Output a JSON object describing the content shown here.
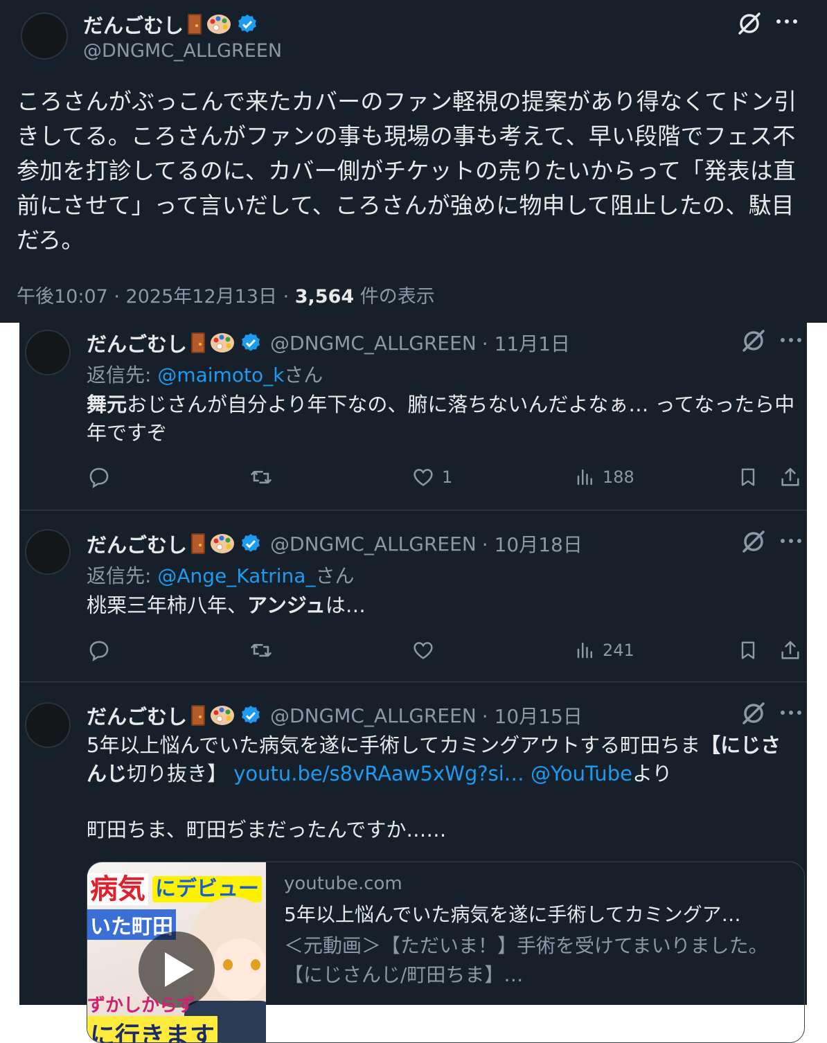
{
  "top_tweet": {
    "name": "だんごむし",
    "handle": "@DNGMC_ALLGREEN",
    "body": "ころさんがぶっこんで来たカバーのファン軽視の提案があり得なくてドン引きしてる。ころさんがファンの事も現場の事も考えて、早い段階でフェス不参加を打診してるのに、カバー側がチケットの売りたいからって「発表は直前にさせて」って言いだして、ころさんが強めに物申して阻止したの、駄目だろ。",
    "time": "午後10:07 · 2025年12月13日 · ",
    "views": "3,564",
    "views_label": " 件の表示"
  },
  "timeline": [
    {
      "name": "だんごむし",
      "handle": "@DNGMC_ALLGREEN",
      "date": "· 11月1日",
      "reply_label": "返信先: ",
      "reply_to": "@maimoto_k",
      "reply_suffix": "さん",
      "text_bold": "舞元",
      "text": "おじさんが自分より年下なの、腑に落ちないんだよなぁ… ってなったら中年ですぞ",
      "likes": "1",
      "views": "188"
    },
    {
      "name": "だんごむし",
      "handle": "@DNGMC_ALLGREEN",
      "date": "· 10月18日",
      "reply_label": "返信先: ",
      "reply_to": "@Ange_Katrina_",
      "reply_suffix": "さん",
      "text_pre": "桃栗三年柿八年、",
      "text_bold": "アンジュ",
      "text_post": "は…",
      "likes": "",
      "views": "241"
    },
    {
      "name": "だんごむし",
      "handle": "@DNGMC_ALLGREEN",
      "date": "· 10月15日",
      "text_pre": "5年以上悩んでいた病気を遂に手術してカミングアウトする町田ちま",
      "text_bold": "【にじさんじ",
      "text_mid": "切り抜き】 ",
      "link1": "youtu.be/s8vRAaw5xWg?si…",
      "link2": "@YouTube",
      "text_post": "より",
      "text2": "町田ちま、町田ぢまだったんですか……",
      "card": {
        "domain": "youtube.com",
        "title": "5年以上悩んでいた病気を遂に手術してカミングア…",
        "description": "＜元動画＞【ただいま！】手術を受けてまいりました。【にじさんじ/町田ちま】…",
        "thumb_line1": "病気",
        "thumb_line2": "にデビュー",
        "thumb_line3": "いた町田",
        "thumb_line4": "ずかしからず",
        "thumb_line5": "に行きます"
      }
    }
  ],
  "colors": {
    "bg": "#15202b",
    "text": "#e7e9ea",
    "muted": "#8b98a5",
    "link": "#1d9bf0",
    "border": "#38444d",
    "verified": "#1d9bf0"
  }
}
